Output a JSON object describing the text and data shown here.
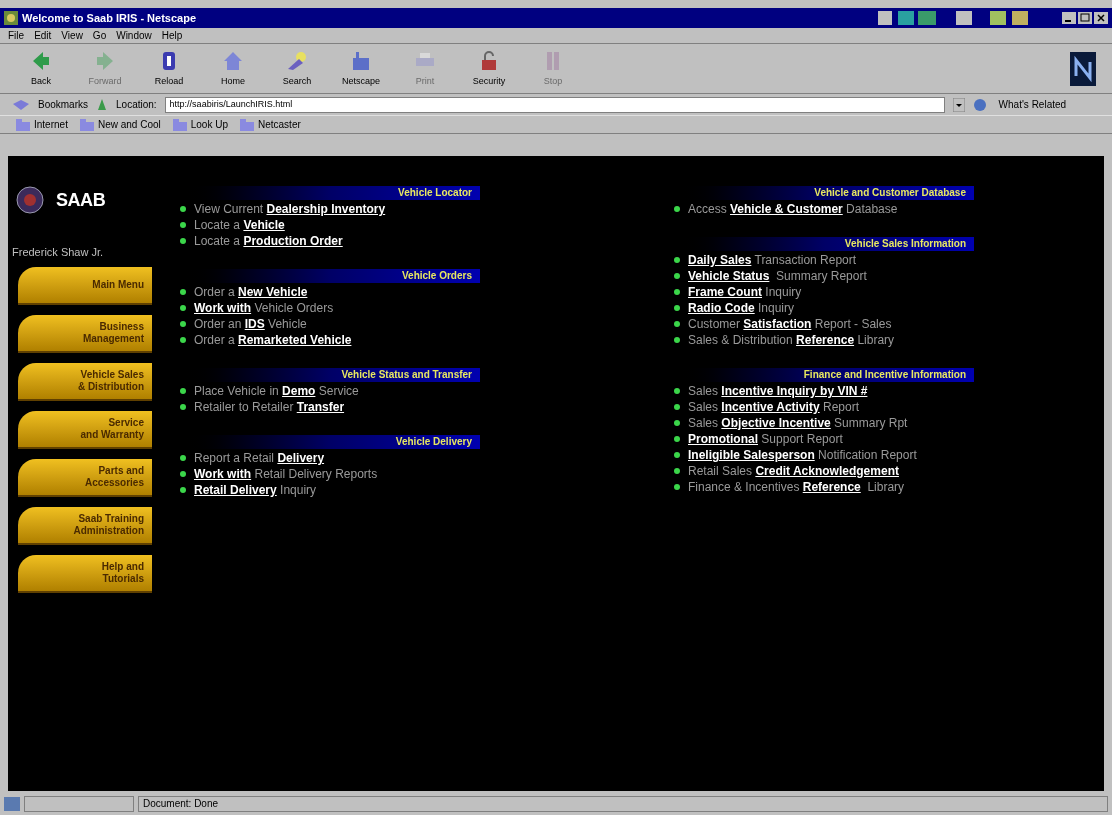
{
  "window": {
    "title": "Welcome to Saab IRIS - Netscape"
  },
  "menu": [
    "File",
    "Edit",
    "View",
    "Go",
    "Window",
    "Help"
  ],
  "toolbar": [
    {
      "label": "Back",
      "disabled": false,
      "kind": "back"
    },
    {
      "label": "Forward",
      "disabled": true,
      "kind": "forward"
    },
    {
      "label": "Reload",
      "disabled": false,
      "kind": "reload"
    },
    {
      "label": "Home",
      "disabled": false,
      "kind": "home"
    },
    {
      "label": "Search",
      "disabled": false,
      "kind": "search"
    },
    {
      "label": "Netscape",
      "disabled": false,
      "kind": "netscape"
    },
    {
      "label": "Print",
      "disabled": true,
      "kind": "print"
    },
    {
      "label": "Security",
      "disabled": false,
      "kind": "security"
    },
    {
      "label": "Stop",
      "disabled": true,
      "kind": "stop"
    }
  ],
  "location_bar": {
    "bookmarks": "Bookmarks",
    "label": "Location:",
    "url": "http://saabiris/LaunchIRIS.html",
    "related": "What's Related"
  },
  "personal_toolbar": [
    "Internet",
    "New and Cool",
    "Look Up",
    "Netcaster"
  ],
  "page": {
    "brand": "SAAB",
    "user": "Frederick Shaw Jr.",
    "nav": [
      [
        "Main Menu"
      ],
      [
        "Business",
        "Management"
      ],
      [
        "Vehicle Sales",
        "& Distribution"
      ],
      [
        "Service",
        "and Warranty"
      ],
      [
        "Parts and",
        "Accessories"
      ],
      [
        "Saab Training",
        "Administration"
      ],
      [
        "Help and",
        "Tutorials"
      ]
    ],
    "columns": [
      [
        {
          "title": "Vehicle Locator",
          "items": [
            [
              {
                "kind": "plain",
                "text": "View Current "
              },
              {
                "kind": "link",
                "text": "Dealership Inventory"
              }
            ],
            [
              {
                "kind": "plain",
                "text": "Locate a "
              },
              {
                "kind": "link",
                "text": "Vehicle"
              }
            ],
            [
              {
                "kind": "plain",
                "text": "Locate a "
              },
              {
                "kind": "link",
                "text": "Production Order"
              }
            ]
          ]
        },
        {
          "title": "Vehicle Orders",
          "items": [
            [
              {
                "kind": "plain",
                "text": "Order a "
              },
              {
                "kind": "link",
                "text": "New Vehicle"
              }
            ],
            [
              {
                "kind": "link",
                "text": "Work with"
              },
              {
                "kind": "plain",
                "text": " Vehicle Orders"
              }
            ],
            [
              {
                "kind": "plain",
                "text": "Order an "
              },
              {
                "kind": "link",
                "text": "IDS"
              },
              {
                "kind": "plain",
                "text": " Vehicle"
              }
            ],
            [
              {
                "kind": "plain",
                "text": "Order a "
              },
              {
                "kind": "link",
                "text": "Remarketed Vehicle"
              }
            ]
          ]
        },
        {
          "title": "Vehicle Status and Transfer",
          "items": [
            [
              {
                "kind": "plain",
                "text": "Place Vehicle in "
              },
              {
                "kind": "link",
                "text": "Demo"
              },
              {
                "kind": "plain",
                "text": " Service"
              }
            ],
            [
              {
                "kind": "plain",
                "text": "Retailer to Retailer "
              },
              {
                "kind": "link",
                "text": "Transfer"
              }
            ]
          ]
        },
        {
          "title": "Vehicle Delivery",
          "items": [
            [
              {
                "kind": "plain",
                "text": "Report a Retail "
              },
              {
                "kind": "link",
                "text": "Delivery"
              }
            ],
            [
              {
                "kind": "link",
                "text": "Work with"
              },
              {
                "kind": "plain",
                "text": " Retail Delivery Reports"
              }
            ],
            [
              {
                "kind": "link",
                "text": "Retail Delivery"
              },
              {
                "kind": "plain",
                "text": " Inquiry"
              }
            ]
          ]
        }
      ],
      [
        {
          "title": "Vehicle and Customer Database",
          "items": [
            [
              {
                "kind": "plain",
                "text": "Access "
              },
              {
                "kind": "link",
                "text": "Vehicle & Customer"
              },
              {
                "kind": "plain",
                "text": " Database"
              }
            ]
          ]
        },
        {
          "title": "Vehicle Sales Information",
          "items": [
            [
              {
                "kind": "link",
                "text": "Daily Sales"
              },
              {
                "kind": "plain",
                "text": " Transaction Report"
              }
            ],
            [
              {
                "kind": "link",
                "text": "Vehicle Status"
              },
              {
                "kind": "plain",
                "text": "  Summary Report"
              }
            ],
            [
              {
                "kind": "link",
                "text": "Frame Count"
              },
              {
                "kind": "plain",
                "text": " Inquiry"
              }
            ],
            [
              {
                "kind": "link",
                "text": "Radio Code"
              },
              {
                "kind": "plain",
                "text": " Inquiry"
              }
            ],
            [
              {
                "kind": "plain",
                "text": "Customer "
              },
              {
                "kind": "link",
                "text": "Satisfaction"
              },
              {
                "kind": "plain",
                "text": " Report - Sales"
              }
            ],
            [
              {
                "kind": "plain",
                "text": "Sales & Distribution "
              },
              {
                "kind": "link",
                "text": "Reference"
              },
              {
                "kind": "plain",
                "text": " Library"
              }
            ]
          ]
        },
        {
          "title": "Finance and Incentive Information",
          "items": [
            [
              {
                "kind": "plain",
                "text": "Sales "
              },
              {
                "kind": "link",
                "text": "Incentive Inquiry by VIN #"
              }
            ],
            [
              {
                "kind": "plain",
                "text": "Sales "
              },
              {
                "kind": "link",
                "text": "Incentive Activity"
              },
              {
                "kind": "plain",
                "text": " Report"
              }
            ],
            [
              {
                "kind": "plain",
                "text": "Sales "
              },
              {
                "kind": "link",
                "text": "Objective Incentive"
              },
              {
                "kind": "plain",
                "text": " Summary Rpt"
              }
            ],
            [
              {
                "kind": "link",
                "text": "Promotional"
              },
              {
                "kind": "plain",
                "text": " Support Report"
              }
            ],
            [
              {
                "kind": "link",
                "text": "Ineligible Salesperson"
              },
              {
                "kind": "plain",
                "text": " Notification Report"
              }
            ],
            [
              {
                "kind": "plain",
                "text": "Retail Sales "
              },
              {
                "kind": "link",
                "text": "Credit Acknowledgement"
              }
            ],
            [
              {
                "kind": "plain",
                "text": "Finance & Incentives "
              },
              {
                "kind": "link",
                "text": "Reference"
              },
              {
                "kind": "plain",
                "text": "  Library"
              }
            ]
          ]
        }
      ]
    ]
  },
  "status_bar": {
    "text": "Document: Done"
  }
}
